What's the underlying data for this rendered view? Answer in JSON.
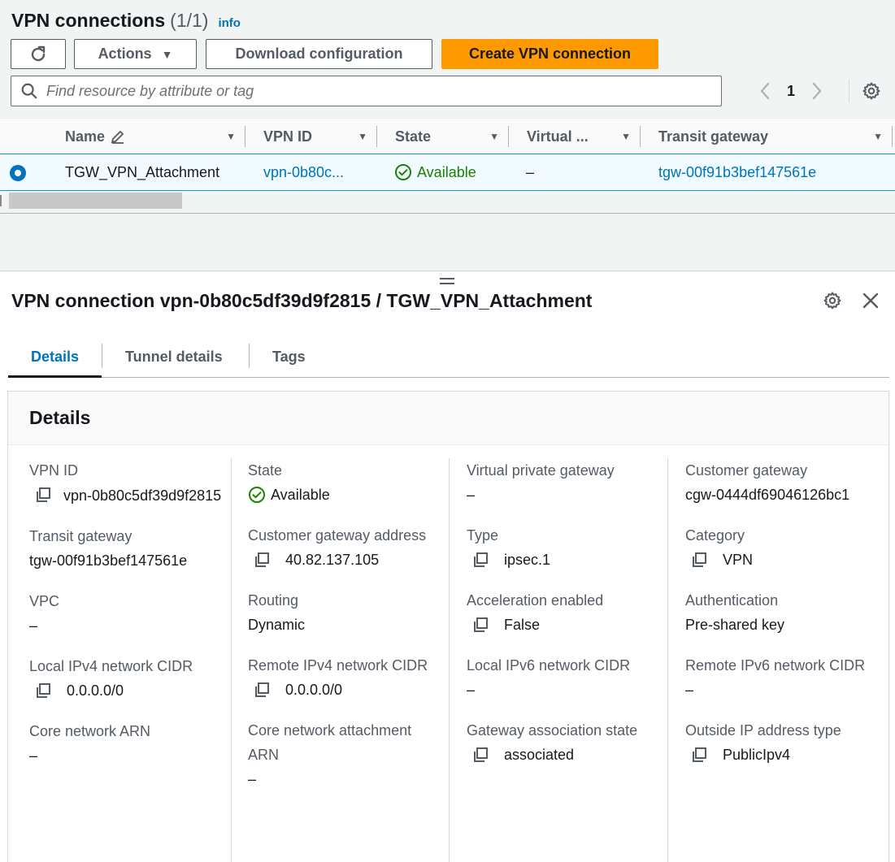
{
  "header": {
    "title": "VPN connections",
    "count": "(1/1)",
    "info": "info"
  },
  "toolbar": {
    "actions_label": "Actions",
    "download_label": "Download configuration",
    "create_label": "Create VPN connection"
  },
  "search": {
    "placeholder": "Find resource by attribute or tag"
  },
  "pagination": {
    "current_page": "1"
  },
  "table": {
    "columns": [
      "Name",
      "VPN ID",
      "State",
      "Virtual ...",
      "Transit gateway"
    ],
    "rows": [
      {
        "name": "TGW_VPN_Attachment",
        "vpn_id": "vpn-0b80c...",
        "state": "Available",
        "virtual": "–",
        "transit_gateway": "tgw-00f91b3bef147561e"
      }
    ]
  },
  "detail": {
    "title": "VPN connection vpn-0b80c5df39d9f2815 / TGW_VPN_Attachment",
    "tabs": [
      "Details",
      "Tunnel details",
      "Tags"
    ],
    "section_title": "Details",
    "col1": {
      "vpn_id_label": "VPN ID",
      "vpn_id_value": "vpn-0b80c5df39d9f2815",
      "tgw_label": "Transit gateway",
      "tgw_value": "tgw-00f91b3bef147561e",
      "vpc_label": "VPC",
      "vpc_value": "–",
      "local_ipv4_label": "Local IPv4 network CIDR",
      "local_ipv4_value": "0.0.0.0/0",
      "core_arn_label": "Core network ARN",
      "core_arn_value": "–"
    },
    "col2": {
      "state_label": "State",
      "state_value": "Available",
      "cgw_addr_label": "Customer gateway address",
      "cgw_addr_value": "40.82.137.105",
      "routing_label": "Routing",
      "routing_value": "Dynamic",
      "remote_ipv4_label": "Remote IPv4 network CIDR",
      "remote_ipv4_value": "0.0.0.0/0",
      "core_attach_label": "Core network attachment ARN",
      "core_attach_value": "–"
    },
    "col3": {
      "vgw_label": "Virtual private gateway",
      "vgw_value": "–",
      "type_label": "Type",
      "type_value": "ipsec.1",
      "accel_label": "Acceleration enabled",
      "accel_value": "False",
      "local_ipv6_label": "Local IPv6 network CIDR",
      "local_ipv6_value": "–",
      "gw_assoc_label": "Gateway association state",
      "gw_assoc_value": "associated"
    },
    "col4": {
      "cgw_label": "Customer gateway",
      "cgw_value": "cgw-0444df69046126bc1",
      "category_label": "Category",
      "category_value": "VPN",
      "auth_label": "Authentication",
      "auth_value": "Pre-shared key",
      "remote_ipv6_label": "Remote IPv6 network CIDR",
      "remote_ipv6_value": "–",
      "outside_ip_label": "Outside IP address type",
      "outside_ip_value": "PublicIpv4"
    }
  },
  "colors": {
    "link": "#0073bb",
    "primary_button": "#ff9900",
    "success": "#1d8102"
  },
  "icons": [
    "refresh-icon",
    "caret-down-icon",
    "search-icon",
    "chevron-left-icon",
    "chevron-right-icon",
    "gear-icon",
    "edit-icon",
    "sort-icon",
    "check-circle-icon",
    "copy-icon",
    "close-icon",
    "drag-handle-icon"
  ]
}
